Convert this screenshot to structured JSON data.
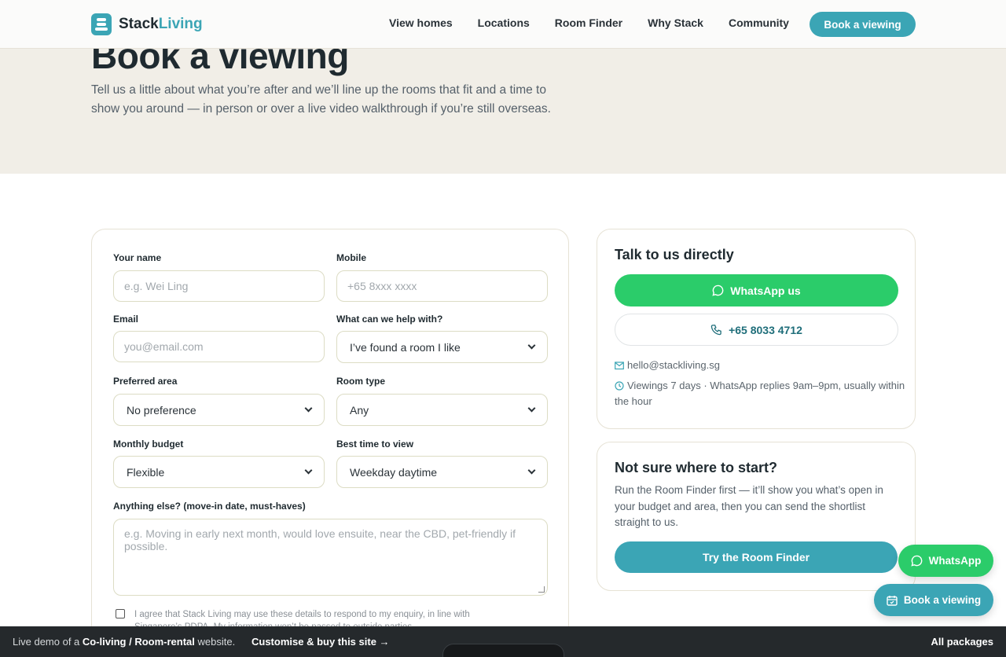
{
  "header": {
    "logo_a": "Stack",
    "logo_b": "Living",
    "nav": [
      "View homes",
      "Locations",
      "Room Finder",
      "Why Stack",
      "Community"
    ],
    "cta": "Book a viewing"
  },
  "hero": {
    "title": "Book a viewing",
    "intro": "Tell us a little about what you’re after and we’ll line up the rooms that fit and a time to show you around — in person or over a live video walkthrough if you’re still overseas."
  },
  "form": {
    "name_label": "Your name",
    "name_placeholder": "e.g. Wei Ling",
    "mobile_label": "Mobile",
    "mobile_placeholder": "+65 8xxx xxxx",
    "email_label": "Email",
    "email_placeholder": "you@email.com",
    "help_label": "What can we help with?",
    "help_value": "I’ve found a room I like",
    "area_label": "Preferred area",
    "area_value": "No preference",
    "roomtype_label": "Room type",
    "roomtype_value": "Any",
    "budget_label": "Monthly budget",
    "budget_value": "Flexible",
    "time_label": "Best time to view",
    "time_value": "Weekday daytime",
    "notes_label": "Anything else? (move-in date, must-haves)",
    "notes_placeholder": "e.g. Moving in early next month, would love ensuite, near the CBD, pet-friendly if possible.",
    "consent": "I agree that Stack Living may use these details to respond to my enquiry, in line with Singapore’s PDPA. My information won’t be passed to outside parties."
  },
  "contact": {
    "title": "Talk to us directly",
    "whatsapp": "WhatsApp us",
    "phone": "+65 8033 4712",
    "email": "hello@stackliving.sg",
    "hours": "Viewings 7 days · WhatsApp replies 9am–9pm, usually within the hour"
  },
  "finder": {
    "title": "Not sure where to start?",
    "text": "Run the Room Finder first — it’ll show you what’s open in your budget and area, then you can send the shortlist straight to us.",
    "cta": "Try the Room Finder"
  },
  "floating": {
    "whatsapp": "WhatsApp",
    "book": "Book a viewing"
  },
  "demo_bar": {
    "prefix": "Live demo of a ",
    "kind": "Co-living / Room-rental",
    "suffix": " website.",
    "buy": "Customise & buy this site →",
    "all": "All packages"
  },
  "colors": {
    "accent": "#3ba5b5",
    "whatsapp": "#2bcc6a",
    "hero_bg": "#f1eee7",
    "bar_bg": "#25292c"
  }
}
